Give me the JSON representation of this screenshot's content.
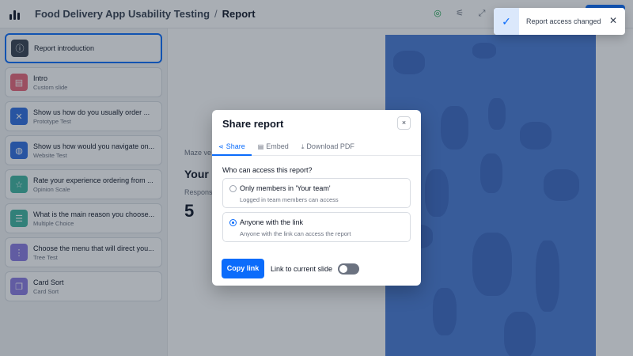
{
  "header": {
    "app_name": "Food Delivery App Usability Testing",
    "separator": "/",
    "current_page": "Report",
    "icons": [
      "check-circle-icon",
      "sliders-icon",
      "expand-icon"
    ]
  },
  "sidebar": {
    "items": [
      {
        "title": "Report introduction",
        "subtitle": "",
        "icon": "info-icon",
        "color": "#374151"
      },
      {
        "title": "Intro",
        "subtitle": "Custom slide",
        "icon": "image-icon",
        "color": "#e8677a"
      },
      {
        "title": "Show us how do you usually order ...",
        "subtitle": "Prototype Test",
        "icon": "tools-icon",
        "color": "#2f6fe0"
      },
      {
        "title": "Show us how would you navigate on...",
        "subtitle": "Website Test",
        "icon": "globe-icon",
        "color": "#2f6fe0"
      },
      {
        "title": "Rate your experience ordering from ...",
        "subtitle": "Opinion Scale",
        "icon": "star-icon",
        "color": "#3fb5a0"
      },
      {
        "title": "What is the main reason you choose...",
        "subtitle": "Multiple Choice",
        "icon": "list-icon",
        "color": "#3fb5a0"
      },
      {
        "title": "Choose the menu that will direct you...",
        "subtitle": "Tree Test",
        "icon": "tree-icon",
        "color": "#8b7be3"
      },
      {
        "title": "Card Sort",
        "subtitle": "Card Sort",
        "icon": "cards-icon",
        "color": "#8b7be3"
      }
    ]
  },
  "main": {
    "maze_version": "Maze ve",
    "heading": "Your f",
    "responses_label": "Respons",
    "responses_value": "5"
  },
  "modal": {
    "title": "Share report",
    "close": "×",
    "tabs": [
      {
        "label": "Share",
        "icon": "share-icon"
      },
      {
        "label": "Embed",
        "icon": "embed-icon"
      },
      {
        "label": "Download PDF",
        "icon": "download-icon"
      }
    ],
    "question": "Who can access this report?",
    "options": [
      {
        "title": "Only members in 'Your team'",
        "subtitle": "Logged in team members can access",
        "selected": false
      },
      {
        "title": "Anyone with the link",
        "subtitle": "Anyone with the link can access the report",
        "selected": true
      }
    ],
    "copy_button": "Copy link",
    "link_toggle_label": "Link to current slide",
    "link_toggle_on": false
  },
  "toast": {
    "message": "Report access changed",
    "close": "✕"
  }
}
